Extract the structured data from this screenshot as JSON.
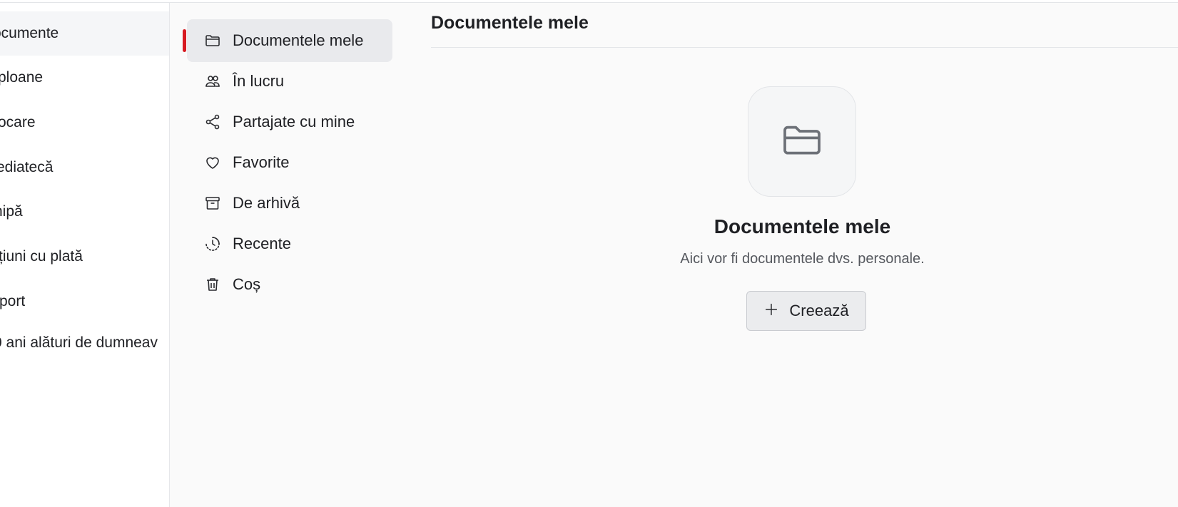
{
  "mainnav": {
    "items": [
      {
        "label": "ocumente",
        "active": true
      },
      {
        "label": "ploane",
        "active": false
      },
      {
        "label": "ocare",
        "active": false
      },
      {
        "label": "ediatecă",
        "active": false
      },
      {
        "label": "hipă",
        "active": false
      },
      {
        "label": "țiuni cu plată",
        "active": false
      },
      {
        "label": "port",
        "active": false
      },
      {
        "label": "0 ani alături de dumneav",
        "active": false
      }
    ]
  },
  "subnav": {
    "items": [
      {
        "label": "Documentele mele",
        "icon": "folder-icon",
        "active": true
      },
      {
        "label": "În lucru",
        "icon": "users-icon",
        "active": false
      },
      {
        "label": "Partajate cu mine",
        "icon": "share-icon",
        "active": false
      },
      {
        "label": "Favorite",
        "icon": "heart-icon",
        "active": false
      },
      {
        "label": "De arhivă",
        "icon": "archive-icon",
        "active": false
      },
      {
        "label": "Recente",
        "icon": "clock-icon",
        "active": false
      },
      {
        "label": "Coș",
        "icon": "trash-icon",
        "active": false
      }
    ]
  },
  "main": {
    "title": "Documentele mele",
    "empty_state": {
      "icon": "folder-icon",
      "title": "Documentele mele",
      "description": "Aici vor fi documentele dvs. personale.",
      "button_label": "Creează",
      "button_icon": "plus-icon"
    }
  },
  "colors": {
    "accent": "#d71920",
    "background": "#fafafa",
    "active_item": "#e9eaed"
  }
}
